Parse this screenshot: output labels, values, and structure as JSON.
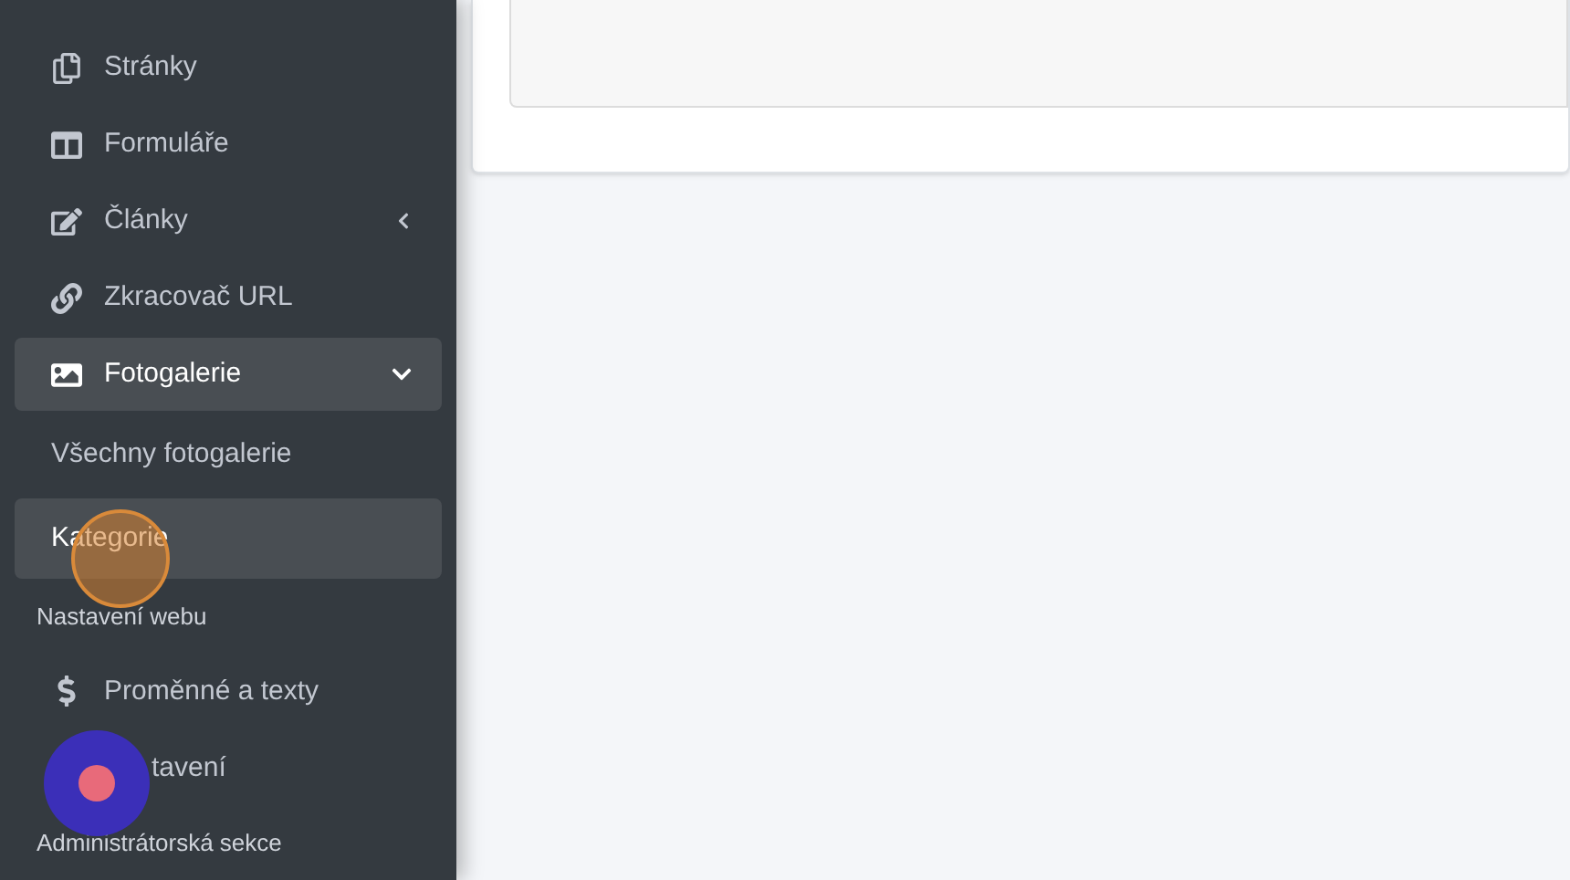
{
  "sidebar": {
    "items": [
      {
        "kind": "link",
        "label": "Stránky",
        "selected": false
      },
      {
        "kind": "link",
        "label": "Formuláře",
        "selected": false
      },
      {
        "kind": "link",
        "label": "Články",
        "selected": false,
        "expanded": false
      },
      {
        "kind": "link",
        "label": "Zkracovač URL",
        "selected": false
      },
      {
        "kind": "link",
        "label": "Fotogalerie",
        "selected": true,
        "expanded": true
      },
      {
        "kind": "subitem",
        "label": "Všechny fotogalerie",
        "selected": false
      },
      {
        "kind": "subitem",
        "label": "Kategorie",
        "selected": true
      },
      {
        "kind": "header",
        "label": "Nastavení webu"
      },
      {
        "kind": "link",
        "label": "Proměnné a texty",
        "selected": false
      },
      {
        "kind": "covered",
        "label": "tavení",
        "selected": false
      },
      {
        "kind": "header",
        "label": "Administrátorská sekce"
      }
    ]
  }
}
